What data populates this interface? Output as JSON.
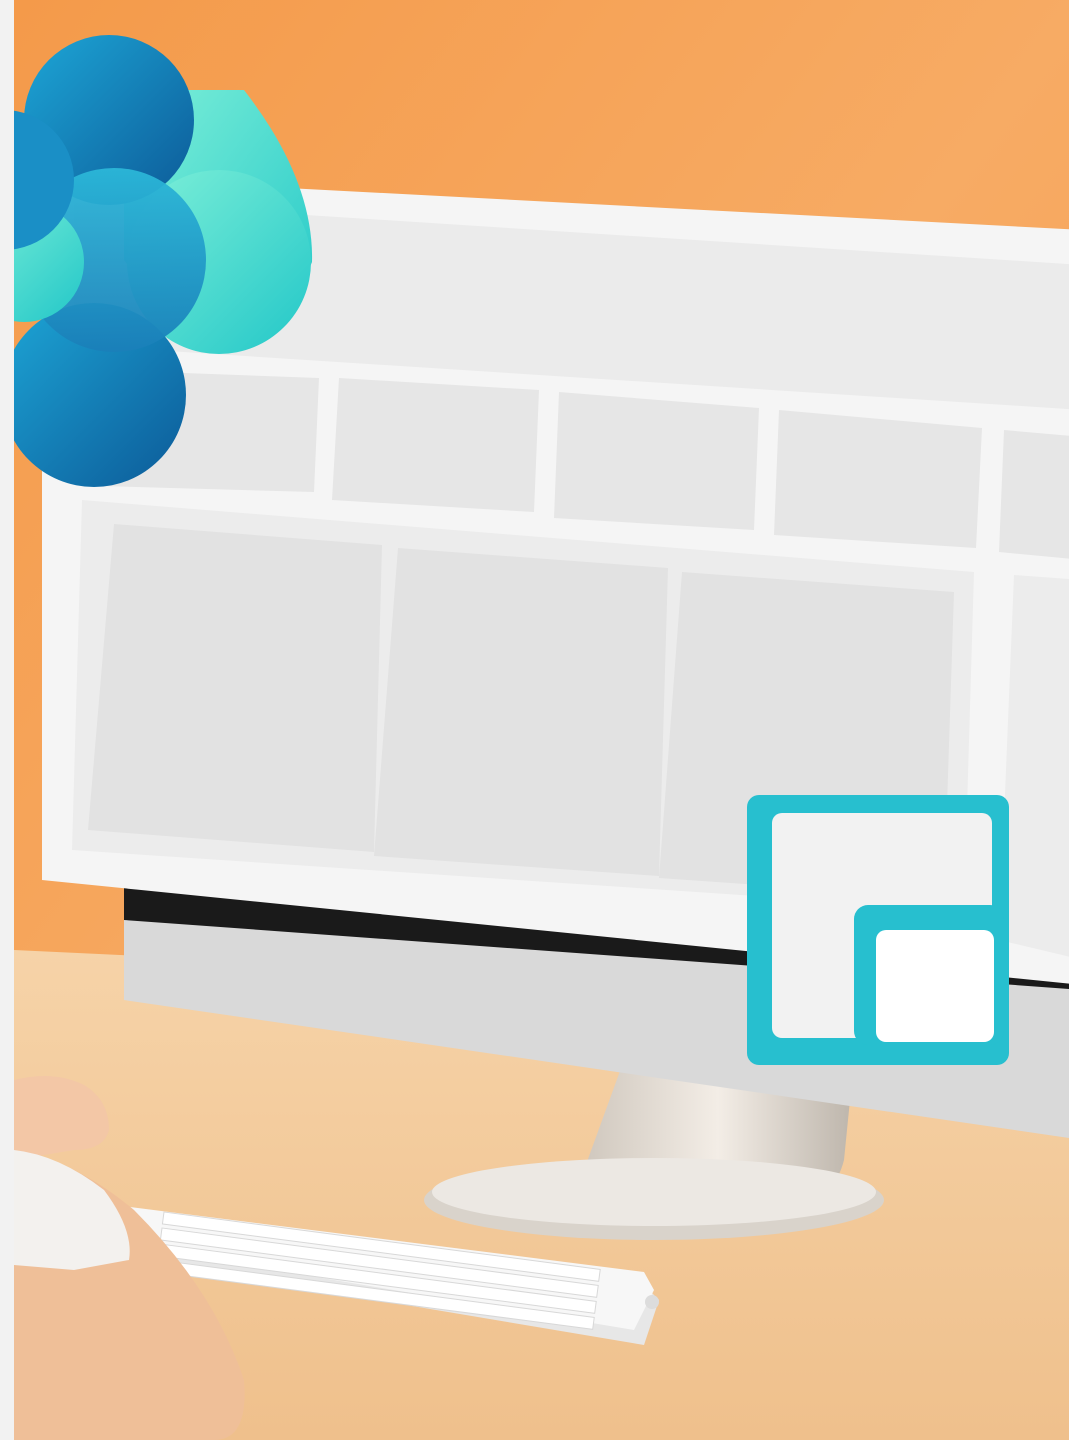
{
  "scene": {
    "description_visible_text": "",
    "colors": {
      "background_orange": "#f4a15a",
      "background_orange_light": "#f8b87a",
      "desk_wood": "#f2c99a",
      "monitor_frame": "#f4f4f4",
      "screen_panel": "#e6e6e6",
      "monitor_bezel_silver": "#d9d9d9",
      "logo_teal": "#3ed6c6",
      "logo_blue": "#1f8fc4",
      "logo_dark_blue": "#0e5e9a",
      "window_icon_teal": "#27bfcf",
      "keyboard_white": "#f5f5f5",
      "skin": "#f1c8a8",
      "shirt": "#f3f1ee"
    },
    "icons": {
      "brand_logo": "flower-logo-icon",
      "overlay_icon": "window-layout-icon"
    }
  }
}
